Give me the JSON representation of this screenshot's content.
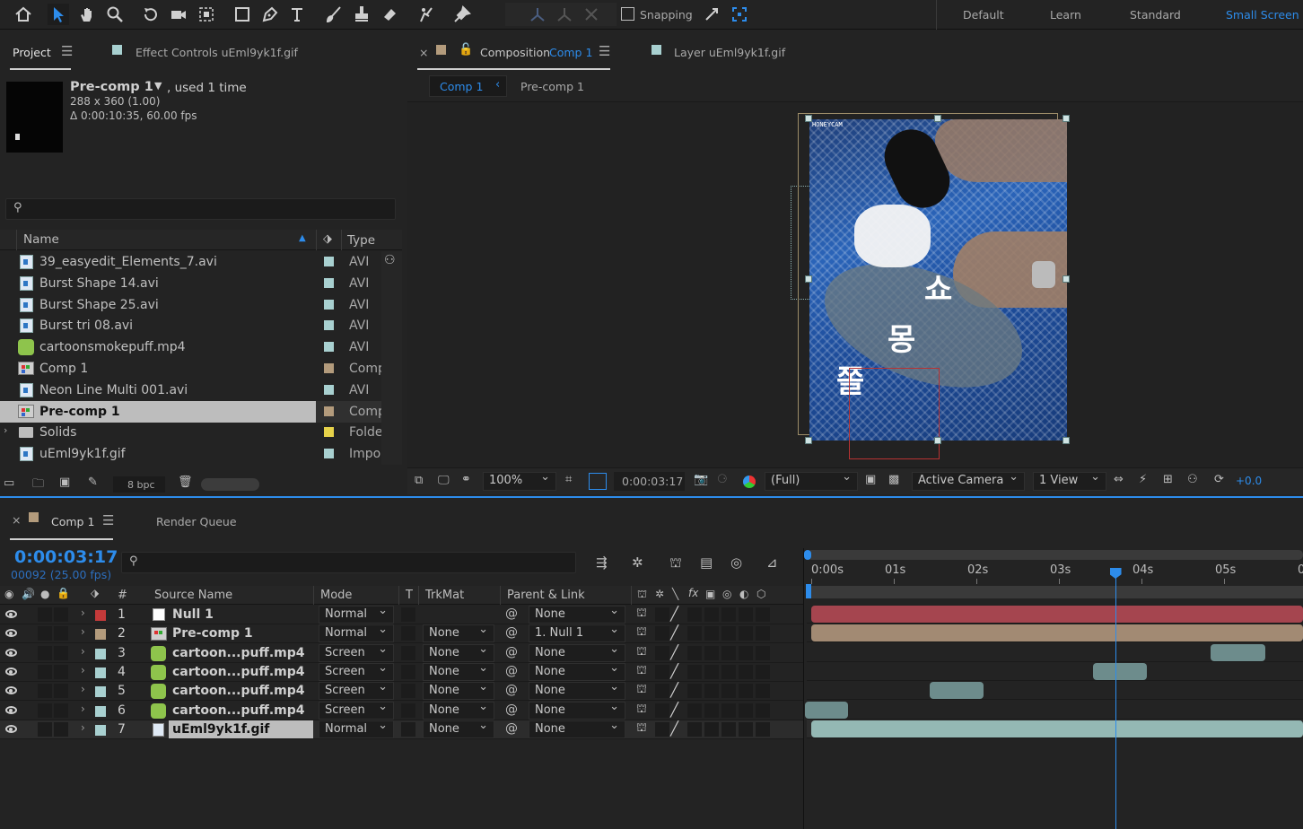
{
  "toolbar": {
    "snapping_label": "Snapping",
    "workspaces": [
      "Default",
      "Learn",
      "Standard",
      "Small Screen"
    ],
    "active_workspace_color": "#2d8ceb"
  },
  "project_panel": {
    "tab_project": "Project",
    "tab_effect_controls": "Effect Controls uEml9yk1f.gif",
    "selected_item": {
      "name": "Pre-comp 1",
      "used": ", used 1 time",
      "size": "288 x 360 (1.00)",
      "duration": "Δ 0:00:10:35, 60.00 fps"
    },
    "columns": {
      "name": "Name",
      "type": "Type"
    },
    "items": [
      {
        "name": "39_easyedit_Elements_7.avi",
        "type": "AVI",
        "color": "#a8d0d0",
        "icon": "avi-file-icon"
      },
      {
        "name": "Burst Shape 14.avi",
        "type": "AVI",
        "color": "#a8d0d0",
        "icon": "avi-file-icon"
      },
      {
        "name": "Burst Shape 25.avi",
        "type": "AVI",
        "color": "#a8d0d0",
        "icon": "avi-file-icon"
      },
      {
        "name": "Burst tri 08.avi",
        "type": "AVI",
        "color": "#a8d0d0",
        "icon": "avi-file-icon"
      },
      {
        "name": "cartoonsmokepuff.mp4",
        "type": "AVI",
        "color": "#a8d0d0",
        "icon": "mp4-file-icon"
      },
      {
        "name": "Comp 1",
        "type": "Comp",
        "color": "#b39b7c",
        "icon": "composition-icon"
      },
      {
        "name": "Neon Line Multi 001.avi",
        "type": "AVI",
        "color": "#a8d0d0",
        "icon": "avi-file-icon"
      },
      {
        "name": "Pre-comp 1",
        "type": "Comp",
        "color": "#b39b7c",
        "icon": "composition-icon"
      },
      {
        "name": "Solids",
        "type": "Folde",
        "color": "#e6d24a",
        "icon": "folder-icon"
      },
      {
        "name": "uEml9yk1f.gif",
        "type": "Impor",
        "color": "#a8d0d0",
        "icon": "gif-file-icon"
      }
    ],
    "bpc": "8 bpc"
  },
  "composition_panel": {
    "tab_label": "Composition",
    "tab_comp": "Comp 1",
    "tab_layer": "Layer uEml9yk1f.gif",
    "crumb_active": "Comp 1",
    "crumb_other": "Pre-comp 1",
    "overlay_watermark": "HONEYCAM",
    "korean_text": [
      "쫄",
      "몽",
      "쇼"
    ],
    "zoom": "100%",
    "timecode": "0:00:03:17",
    "resolution": "(Full)",
    "camera": "Active Camera",
    "views": "1 View",
    "exposure": "+0.0"
  },
  "timeline": {
    "tab_comp": "Comp 1",
    "tab_render": "Render Queue",
    "current_time": "0:00:03:17",
    "frame_info": "00092 (25.00 fps)",
    "columns": {
      "num": "#",
      "source": "Source Name",
      "mode": "Mode",
      "t": "T",
      "trkmat": "TrkMat",
      "parent": "Parent & Link"
    },
    "ruler": [
      "0:00s",
      "01s",
      "02s",
      "03s",
      "04s",
      "05s",
      "0"
    ],
    "playhead_sec": 3.68,
    "layers": [
      {
        "num": "1",
        "name": "Null 1",
        "label": "#c43a3a",
        "mode": "Normal",
        "trkmat": "",
        "parent": "None",
        "bar_start": 0,
        "bar_end": 6.5,
        "bar_color": "#a5454f",
        "icon": "null-icon"
      },
      {
        "num": "2",
        "name": "Pre-comp 1",
        "label": "#b39b7c",
        "mode": "Normal",
        "trkmat": "None",
        "parent": "1. Null 1",
        "bar_start": 0,
        "bar_end": 6.5,
        "bar_color": "#a28a73",
        "icon": "composition-icon"
      },
      {
        "num": "3",
        "name": "cartoon...puff.mp4",
        "label": "#a8d0d0",
        "mode": "Screen",
        "trkmat": "None",
        "parent": "None",
        "bar_start": 4.84,
        "bar_end": 5.5,
        "bar_color": "#6d8c8c",
        "icon": "mp4-file-icon"
      },
      {
        "num": "4",
        "name": "cartoon...puff.mp4",
        "label": "#a8d0d0",
        "mode": "Screen",
        "trkmat": "None",
        "parent": "None",
        "bar_start": 3.41,
        "bar_end": 4.07,
        "bar_color": "#6d8c8c",
        "icon": "mp4-file-icon"
      },
      {
        "num": "5",
        "name": "cartoon...puff.mp4",
        "label": "#a8d0d0",
        "mode": "Screen",
        "trkmat": "None",
        "parent": "None",
        "bar_start": 1.43,
        "bar_end": 2.09,
        "bar_color": "#6d8c8c",
        "icon": "mp4-file-icon"
      },
      {
        "num": "6",
        "name": "cartoon...puff.mp4",
        "label": "#a8d0d0",
        "mode": "Screen",
        "trkmat": "None",
        "parent": "None",
        "bar_start": -0.1,
        "bar_end": 0.45,
        "bar_color": "#6d8c8c",
        "icon": "mp4-file-icon"
      },
      {
        "num": "7",
        "name": "uEml9yk1f.gif",
        "label": "#a8d0d0",
        "mode": "Normal",
        "trkmat": "None",
        "parent": "None",
        "bar_start": 0,
        "bar_end": 6.5,
        "bar_color": "#94b8b4",
        "icon": "gif-file-icon",
        "selected": true
      }
    ]
  }
}
